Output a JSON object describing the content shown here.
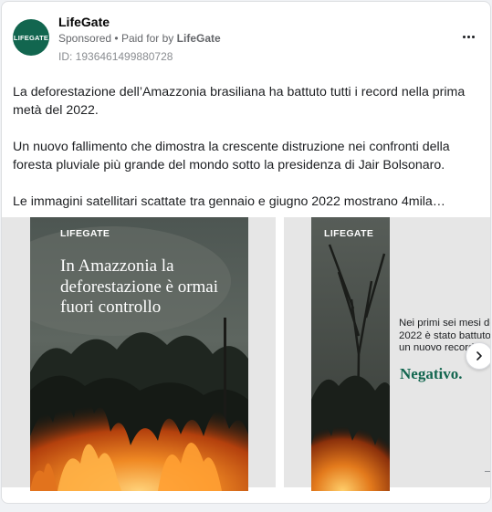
{
  "post": {
    "page_name": "LifeGate",
    "avatar_text": "LIFEGATE",
    "sponsored_label": "Sponsored",
    "separator": "•",
    "paid_for_prefix": "Paid for by",
    "paid_for_name": "LifeGate",
    "ad_id": "ID: 1936461499880728",
    "more_icon": "more-horizontal-icon"
  },
  "body": {
    "paragraphs": [
      "La deforestazione dell’Amazzonia brasiliana ha battuto tutti i record nella prima metà del 2022.",
      "Un nuovo fallimento che dimostra la crescente distruzione nei confronti della foresta pluviale più grande del mondo sotto la presidenza di Jair Bolsonaro.",
      "Le immagini satellitari scattate tra gennaio e giugno 2022 mostrano 4mila…"
    ]
  },
  "carousel": {
    "cards": [
      {
        "brand": "LIFEGATE",
        "headline": "In Amazzonia la deforestazione è ormai fuori controllo"
      },
      {
        "brand": "LIFEGATE",
        "copy_lines": [
          "Nei primi sei mesi del",
          "2022 è stato battuto",
          "un nuovo record"
        ],
        "accent_word": "Negativo."
      }
    ],
    "next_icon": "chevron-right-icon"
  },
  "colors": {
    "brand_green": "#12664f",
    "text_primary": "#1c1e21",
    "text_secondary": "#65676b"
  }
}
